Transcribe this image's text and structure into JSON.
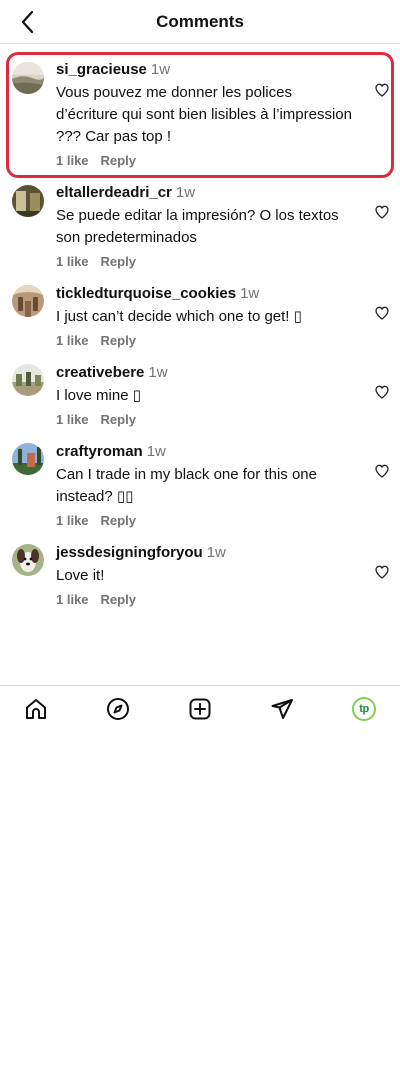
{
  "header": {
    "title": "Comments",
    "back_icon": "chevron-left-icon"
  },
  "comments": [
    {
      "username": "si_gracieuse",
      "time": "1w",
      "text": "Vous pouvez me donner les polices d’écriture qui sont bien lisibles à l’impression ??? Car pas top !",
      "likes": "1 like",
      "reply": "Reply",
      "highlighted": true,
      "highlight_color": "#e0283e"
    },
    {
      "username": "eltallerdeadri_cr",
      "time": "1w",
      "text": "Se puede editar la impresión? O los textos son predeterminados",
      "likes": "1 like",
      "reply": "Reply"
    },
    {
      "username": "tickledturquoise_cookies",
      "time": "1w",
      "text": "I just can’t decide which one to get! ▯",
      "likes": "1 like",
      "reply": "Reply"
    },
    {
      "username": "creativebere",
      "time": "1w",
      "text": "I love mine ▯",
      "likes": "1 like",
      "reply": "Reply"
    },
    {
      "username": "craftyroman",
      "time": "1w",
      "text": "Can I trade in my black one for this one instead? ▯▯",
      "likes": "1 like",
      "reply": "Reply"
    },
    {
      "username": "jessdesigningforyou",
      "time": "1w",
      "text": "Love it!",
      "likes": "1 like",
      "reply": "Reply"
    }
  ],
  "bottom_nav": {
    "items": [
      "home-icon",
      "explore-compass-icon",
      "create-plus-icon",
      "direct-send-icon",
      "profile-avatar-icon"
    ],
    "profile_badge": "tp",
    "profile_color": "#7fd14c"
  }
}
